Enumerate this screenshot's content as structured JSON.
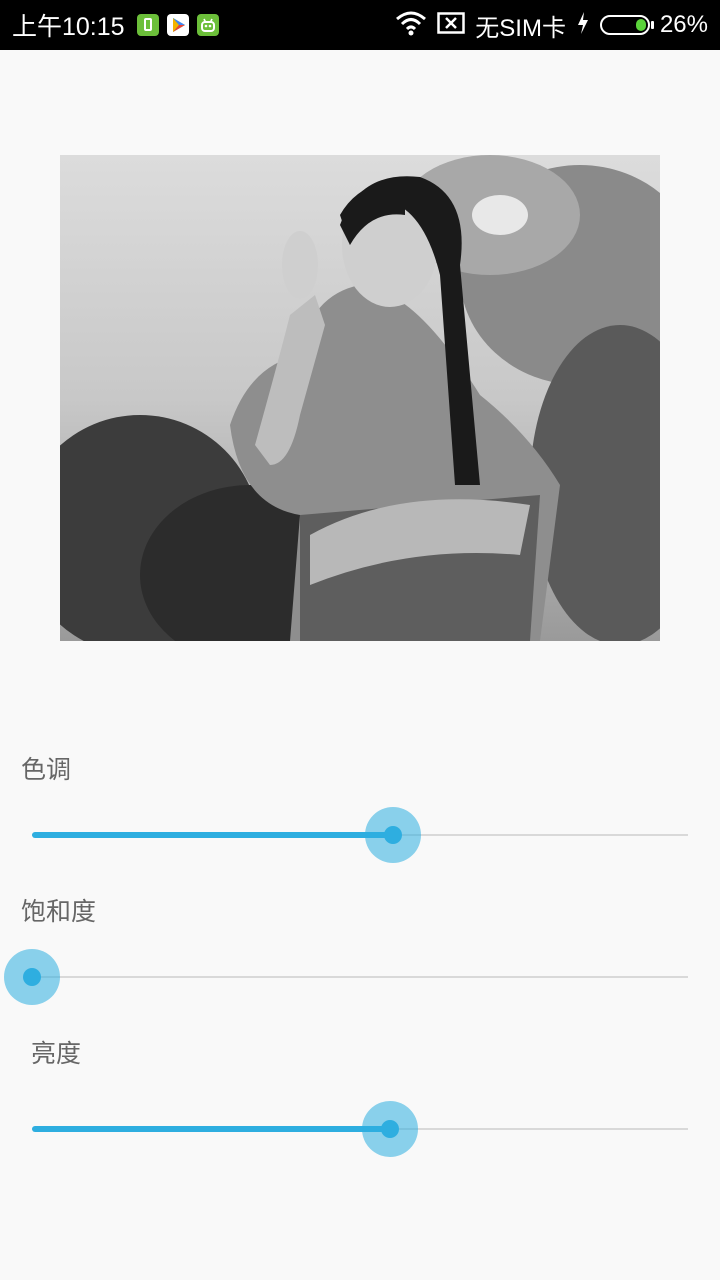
{
  "status_bar": {
    "time": "上午10:15",
    "carrier": "无SIM卡",
    "battery": "26%",
    "icons": [
      "sim-app-icon",
      "play-store-icon",
      "android-icon",
      "wifi-icon",
      "no-sim-icon",
      "charging-icon",
      "battery-icon"
    ]
  },
  "colors": {
    "accent": "#2eaee0",
    "thumb_halo": "#7fd0ef",
    "track": "#d9d9d9",
    "label": "#666666",
    "background": "#f9f9f9"
  },
  "sliders": [
    {
      "label": "色调",
      "value_fraction": 0.55
    },
    {
      "label": "饱和度",
      "value_fraction": 0.0
    },
    {
      "label": "亮度",
      "value_fraction": 0.545
    }
  ]
}
